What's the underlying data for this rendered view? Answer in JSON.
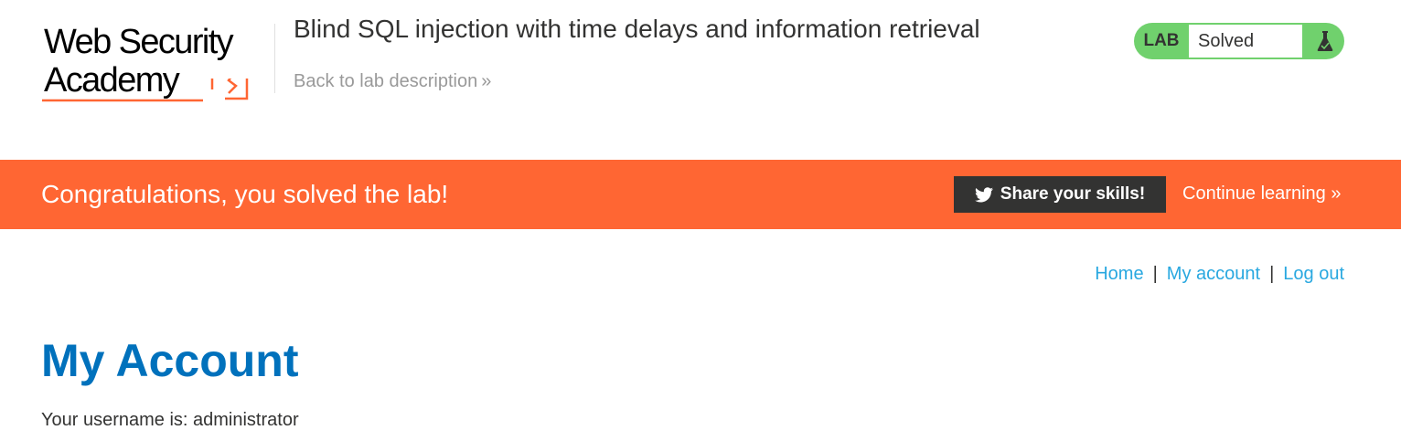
{
  "header": {
    "logo_line1": "Web Security",
    "logo_line2": "Academy",
    "lab_title": "Blind SQL injection with time delays and information retrieval",
    "back_link": "Back to lab description",
    "back_chevron": "»",
    "status": {
      "label": "LAB",
      "value": "Solved",
      "icon": "flask-icon",
      "color": "#70d16d"
    }
  },
  "banner": {
    "message": "Congratulations, you solved the lab!",
    "share_label": "Share your skills!",
    "share_icon": "twitter-icon",
    "continue_label": "Continue learning",
    "continue_chevron": "»",
    "color": "#ff6633"
  },
  "nav": {
    "items": [
      {
        "label": "Home"
      },
      {
        "label": "My account"
      },
      {
        "label": "Log out"
      }
    ],
    "separator": "|"
  },
  "main": {
    "title": "My Account",
    "username_line": "Your username is: administrator"
  },
  "colors": {
    "brand_orange": "#ff6633",
    "link_blue": "#29a8e0",
    "title_blue": "#0071bc",
    "dark": "#333332"
  }
}
